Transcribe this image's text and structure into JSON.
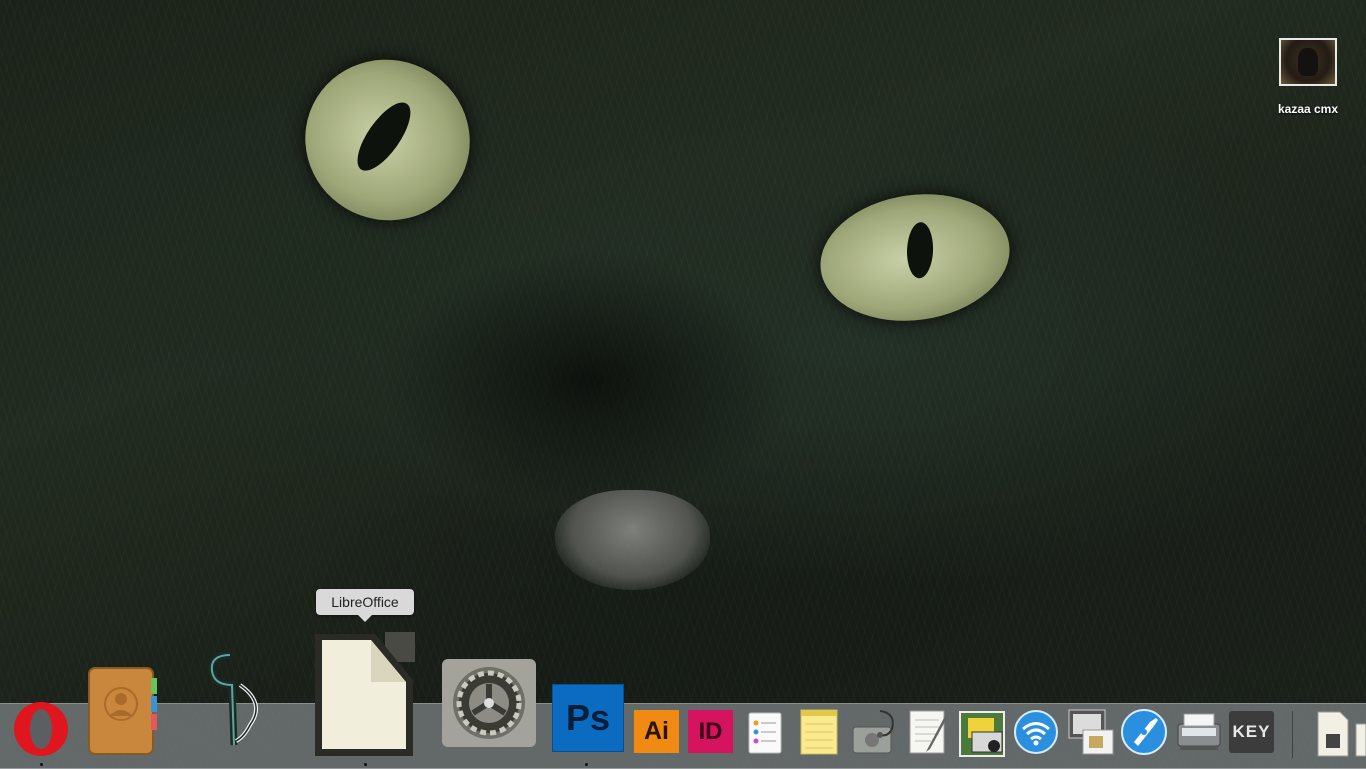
{
  "desktop": {
    "item": {
      "label": "kazaa cmx",
      "icon": "image-thumbnail"
    }
  },
  "tooltip": {
    "text": "LibreOffice"
  },
  "dock": {
    "apps": [
      {
        "id": "opera",
        "icon": "opera-icon",
        "running": true
      },
      {
        "id": "contacts",
        "icon": "contacts-icon",
        "running": false
      },
      {
        "id": "scrivener",
        "icon": "scrivener-icon",
        "running": false
      },
      {
        "id": "libreoffice",
        "icon": "libreoffice-icon",
        "running": true
      },
      {
        "id": "system-preferences",
        "icon": "gear-icon",
        "running": false
      },
      {
        "id": "photoshop",
        "icon": "photoshop-icon",
        "label": "Ps",
        "running": true
      },
      {
        "id": "illustrator",
        "icon": "illustrator-icon",
        "label": "Ai",
        "running": false
      },
      {
        "id": "indesign",
        "icon": "indesign-icon",
        "label": "ID",
        "running": false
      },
      {
        "id": "reminders",
        "icon": "reminders-icon",
        "running": false
      },
      {
        "id": "notes",
        "icon": "notes-icon",
        "running": false
      },
      {
        "id": "disk-utility",
        "icon": "disk-utility-icon",
        "running": false
      },
      {
        "id": "textedit",
        "icon": "textedit-icon",
        "running": false
      },
      {
        "id": "app-store-old",
        "icon": "toolbox-icon",
        "running": false
      },
      {
        "id": "wifi",
        "icon": "wifi-icon",
        "running": false
      },
      {
        "id": "preview",
        "icon": "preview-icon",
        "running": false
      },
      {
        "id": "xcode-instruments",
        "icon": "instruments-icon",
        "running": false
      },
      {
        "id": "image-capture",
        "icon": "scanner-icon",
        "running": false
      },
      {
        "id": "keynote",
        "icon": "keynote-icon",
        "label": "KEY",
        "running": false
      },
      {
        "id": "downloads",
        "icon": "document-icon",
        "running": false
      }
    ]
  },
  "colors": {
    "dock_bg": "#7b8083",
    "opera_red": "#e0161f",
    "photoshop_blue": "#0b6bc0",
    "illustrator_orange": "#f08a12",
    "indesign_pink": "#d5135e",
    "keynote_bg": "#3c3c3c"
  }
}
